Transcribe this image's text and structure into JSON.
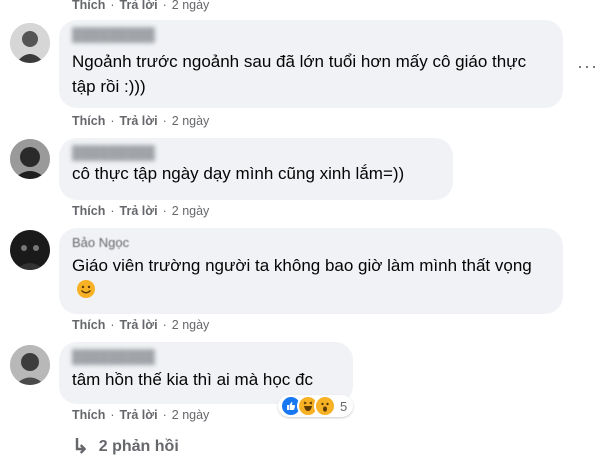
{
  "top_actions": {
    "like": "Thích",
    "reply": "Trả lời",
    "time": "2 ngày"
  },
  "comments": [
    {
      "author": "",
      "text": "Ngoảnh trước ngoảnh sau đã lớn tuổi hơn mấy cô giáo thực tập rồi :)))",
      "like": "Thích",
      "reply": "Trả lời",
      "time": "2 ngày",
      "more": "···"
    },
    {
      "author": "",
      "text": "cô thực tập ngày dạy mình cũng xinh lắm=))",
      "like": "Thích",
      "reply": "Trả lời",
      "time": "2 ngày"
    },
    {
      "author": "Bảo Ngọc",
      "text": "Giáo viên trường người ta không bao giờ làm mình thất vọng",
      "like": "Thích",
      "reply": "Trả lời",
      "time": "2 ngày",
      "emoji": "smiling-face"
    },
    {
      "author": "",
      "text": "tâm hồn thế kia thì ai mà học đc",
      "like": "Thích",
      "reply": "Trả lời",
      "time": "2 ngày",
      "reactions": {
        "icons": [
          "like",
          "haha",
          "wow"
        ],
        "count": "5"
      }
    }
  ],
  "replies_link": {
    "arrow": "↳",
    "label": "2 phản hồi"
  },
  "colors": {
    "bubble": "#f0f2f5",
    "meta": "#65676b",
    "text": "#050505",
    "like_blue": "#1877f2",
    "emoji_yellow": "#f7b125"
  }
}
